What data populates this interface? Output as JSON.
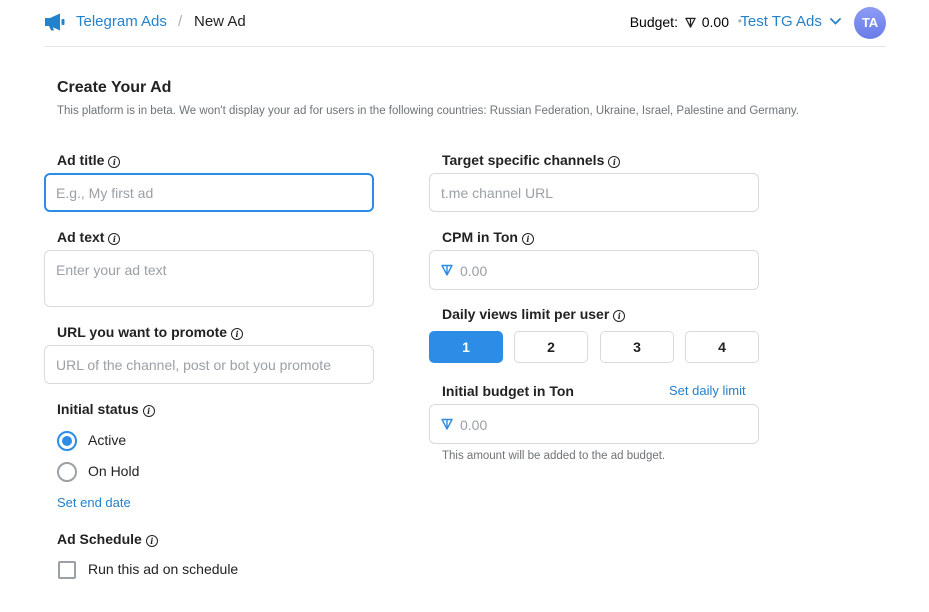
{
  "header": {
    "brand": "Telegram Ads",
    "separator": "/",
    "crumb": "New Ad",
    "budget_label": "Budget:",
    "budget_value": "0.00",
    "dot": "•",
    "account_name": "Test TG Ads",
    "avatar_initials": "TA"
  },
  "page": {
    "title": "Create Your Ad",
    "description": "This platform is in beta. We won't display your ad for users in the following countries: Russian Federation, Ukraine, Israel, Palestine and Germany."
  },
  "form": {
    "ad_title": {
      "label": "Ad title",
      "placeholder": "E.g., My first ad",
      "value": ""
    },
    "ad_text": {
      "label": "Ad text",
      "placeholder": "Enter your ad text",
      "value": ""
    },
    "url": {
      "label": "URL you want to promote",
      "placeholder": "URL of the channel, post or bot you promote",
      "value": ""
    },
    "initial_status": {
      "label": "Initial status",
      "options": [
        {
          "label": "Active",
          "checked": true
        },
        {
          "label": "On Hold",
          "checked": false
        }
      ]
    },
    "set_end_date": "Set end date",
    "ad_schedule": {
      "label": "Ad Schedule",
      "checkbox_label": "Run this ad on schedule",
      "checked": false
    },
    "target_channels": {
      "label": "Target specific channels",
      "placeholder": "t.me channel URL",
      "value": ""
    },
    "cpm": {
      "label": "CPM in Ton",
      "placeholder": "0.00",
      "value": ""
    },
    "daily_views": {
      "label": "Daily views limit per user",
      "options": [
        "1",
        "2",
        "3",
        "4"
      ],
      "selected": "1"
    },
    "initial_budget": {
      "label": "Initial budget in Ton",
      "link": "Set daily limit",
      "placeholder": "0.00",
      "value": "",
      "hint": "This amount will be added to the ad budget."
    }
  },
  "colors": {
    "accent": "#2481cc",
    "active": "#2c8ce6",
    "ton": "#2c8ce6",
    "avatar": "#7b8cf0"
  },
  "icons": {
    "logo": "megaphone-icon",
    "info": "info-icon",
    "currency": "ton-icon",
    "dropdown": "chevron-down-icon"
  }
}
